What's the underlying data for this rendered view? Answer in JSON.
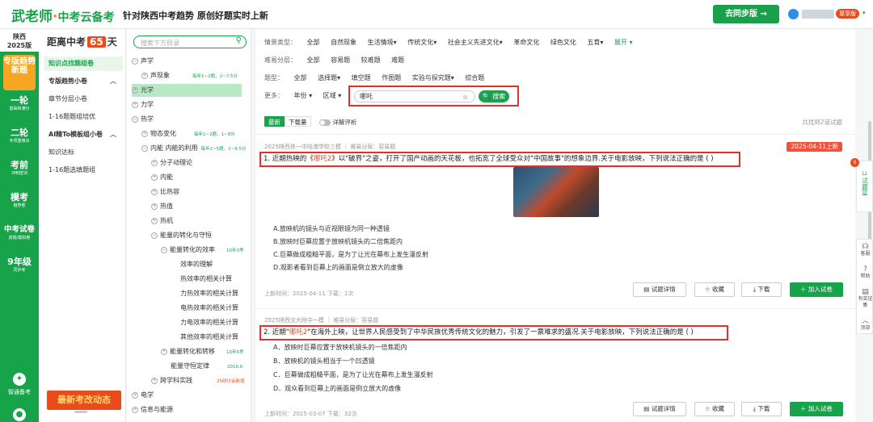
{
  "header": {
    "logo_main": "武老师",
    "logo_dot": "·",
    "logo_sub": "中考云备考",
    "slogan": "针对陕西中考趋势 原创好题实时上新",
    "sync_button": "去同步版 →",
    "vip_badge": "尊享版"
  },
  "left_nav": {
    "province": "陕西",
    "year": "2025版",
    "items": [
      {
        "label": "专版趋势新题",
        "sub": ""
      },
      {
        "label": "一轮",
        "sub": "基础和满分"
      },
      {
        "label": "二轮",
        "sub": "专项重难点"
      },
      {
        "label": "考前",
        "sub": "冲刺密训"
      },
      {
        "label": "模考",
        "sub": "趋势卷"
      },
      {
        "label": "中考试卷",
        "sub": "真题/模拟卷"
      },
      {
        "label": "9年级",
        "sub": "同步考"
      }
    ],
    "bottom_label": "智通备考"
  },
  "menu": {
    "countdown_prefix": "距离中考",
    "countdown_days": "65",
    "countdown_suffix": "天",
    "items": [
      "知识点找题组卷",
      "专版趋势小卷",
      "章节分层小卷",
      "1-16题题组培优",
      "AI精To模板组小卷",
      "知识达标",
      "1-16题选填题组"
    ],
    "news": "最新考改动态"
  },
  "tree": {
    "search_placeholder": "搜索下方目录",
    "nodes": [
      {
        "label": "声学",
        "count": ""
      },
      {
        "label": "声现象",
        "count": "每年1~2题，2~7.5分"
      },
      {
        "label": "光学",
        "count": ""
      },
      {
        "label": "力学",
        "count": ""
      },
      {
        "label": "热学",
        "count": ""
      },
      {
        "label": "物态变化",
        "count": "每年1~2题，1~9分"
      },
      {
        "label": "内能 内能的利用",
        "count": "每年2~5题，1~9.5分"
      },
      {
        "label": "分子动理论",
        "count": ""
      },
      {
        "label": "内能",
        "count": ""
      },
      {
        "label": "比热容",
        "count": ""
      },
      {
        "label": "热值",
        "count": ""
      },
      {
        "label": "热机",
        "count": ""
      },
      {
        "label": "能量的转化与守恒",
        "count": ""
      },
      {
        "label": "能量转化的效率",
        "count": "10年3考"
      },
      {
        "label": "效率的理解",
        "count": ""
      },
      {
        "label": "热效率的相关计算",
        "count": ""
      },
      {
        "label": "力热效率的相关计算",
        "count": ""
      },
      {
        "label": "电热效率的相关计算",
        "count": ""
      },
      {
        "label": "力电效率的相关计算",
        "count": ""
      },
      {
        "label": "其他效率的相关计算",
        "count": ""
      },
      {
        "label": "能量转化和转移",
        "count": "10年5考"
      },
      {
        "label": "能量守恒定律",
        "count": "2016.6"
      },
      {
        "label": "跨学科实践",
        "count": "25研讨会新增"
      },
      {
        "label": "电学",
        "count": ""
      },
      {
        "label": "信息与能源",
        "count": ""
      }
    ]
  },
  "filters": {
    "situation_label": "情景类型：",
    "situation_options": [
      "全部",
      "自然现象",
      "生活情境▾",
      "传统文化▾",
      "社会主义先进文化▾",
      "革命文化",
      "绿色文化",
      "五育▾",
      "展开 ▾"
    ],
    "difficulty_label": "难易分层：",
    "difficulty_options": [
      "全部",
      "容易题",
      "较难题",
      "难题"
    ],
    "type_label": "题型：",
    "type_options": [
      "全部",
      "选择题▾",
      "填空题",
      "作图题",
      "实验与探究题▾",
      "综合题"
    ],
    "more_label": "更多：",
    "year_select": "年份 ▾",
    "region_select": "区域 ▾",
    "search_value": "哪吒",
    "search_button": "🔍 搜索"
  },
  "tabs": {
    "latest": "最新",
    "downloads": "下载量",
    "detail_toggle": "详解评析",
    "found_text": "共找到2道试题"
  },
  "questions": [
    {
      "source": "2025陕西铁一中陆港学校三模 ｜ 难易分层：容易题",
      "date_badge": "2025-04-11上新",
      "stem_prefix": "1. 近期热映的《",
      "stem_highlight": "哪吒2",
      "stem_suffix": "》以\"破界\"之姿，打开了国产动画的天花板，也拓宽了全球受众对\"中国故事\"的想象边界.关于电影放映，下列说法正确的是 (        )",
      "options": [
        "A.放映机的镜头与近视眼镜为同一种透镜",
        "B.放映时巨幕应置于放映机镜头的二倍焦距内",
        "C.巨幕做成粗糙平面，是为了让光在幕布上发生漫反射",
        "D.观影者看到巨幕上的画面是倒立放大的虚像"
      ],
      "meta": "上新时间：2025-04-11    下载：1次",
      "btn_detail": "试题详情",
      "btn_fav": "收藏",
      "btn_download": "下载",
      "btn_add": "＋ 加入试卷"
    },
    {
      "source": "2025陕西交大附中一模 ｜ 难易分层：容易题",
      "date_badge": "",
      "stem_prefix": "2. 近期\"",
      "stem_highlight": "哪吒2",
      "stem_suffix": "\"在海外上映，让世界人民感受到了中华民族优秀传统文化的魅力，引发了一票难求的盛况.关于电影放映，下列说法正确的是 (      )",
      "options": [
        "A．放映时巨幕应置于放映机镜头的一倍焦距内",
        "B．放映机的镜头相当于一个凹透镜",
        "C．巨幕做成粗糙平面，是为了让光在幕布上发生漫反射",
        "D．观众看到巨幕上的画面是倒立放大的虚像"
      ],
      "meta": "上新时间：2025-03-07    下载：32次",
      "btn_detail": "试题详情",
      "btn_fav": "收藏",
      "btn_download": "下载",
      "btn_add": "＋ 加入试卷"
    }
  ],
  "right_tools": {
    "basket_count": "0",
    "basket_label": "试题篮",
    "tools": [
      "客服",
      "帮助",
      "有奖征集",
      "顶部"
    ]
  }
}
